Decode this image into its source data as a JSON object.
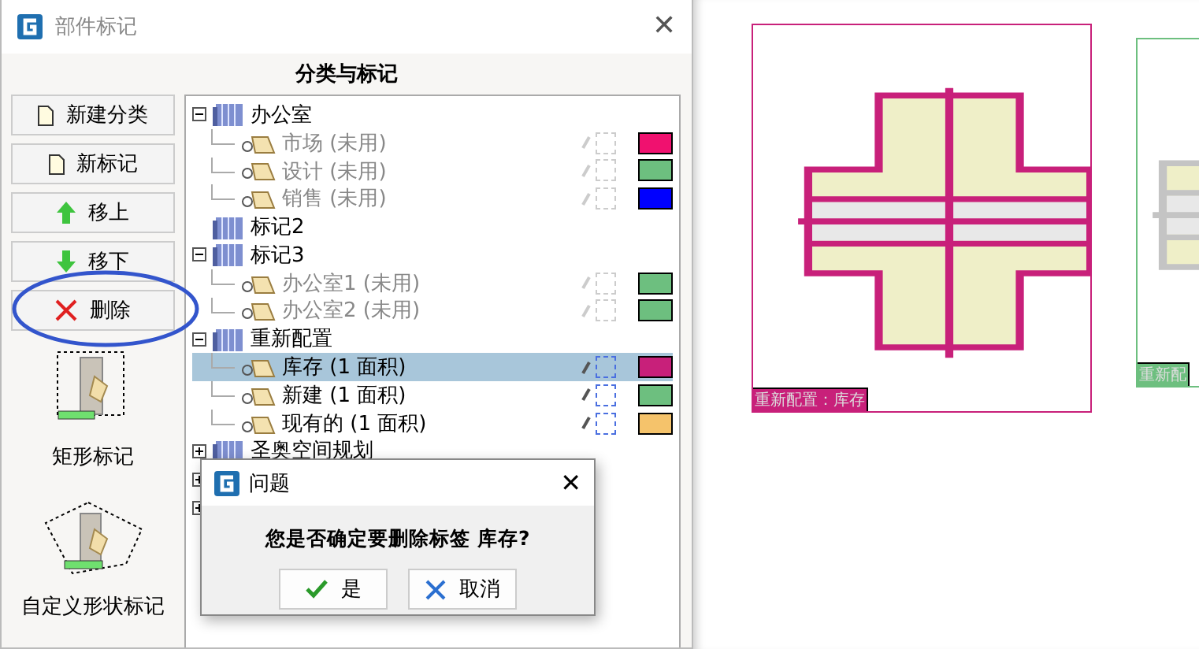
{
  "window": {
    "title": "部件标记",
    "close": "✕"
  },
  "header": "分类与标记",
  "buttons": [
    {
      "label": "新建分类",
      "kind": "doc",
      "circled": false
    },
    {
      "label": "新标记",
      "kind": "doc",
      "circled": false
    },
    {
      "label": "移上",
      "kind": "up",
      "circled": false
    },
    {
      "label": "移下",
      "kind": "down",
      "circled": false
    },
    {
      "label": "删除",
      "kind": "delete",
      "circled": true
    }
  ],
  "tools": [
    {
      "label": "矩形标记",
      "kind": "rect"
    },
    {
      "label": "自定义形状标记",
      "kind": "custom"
    }
  ],
  "tree": [
    {
      "label": "办公室",
      "expanded": true,
      "children": [
        {
          "label": "市场 (未用)",
          "used": false,
          "selected": false,
          "color": "#f0116f"
        },
        {
          "label": "设计 (未用)",
          "used": false,
          "selected": false,
          "color": "#6dbf7f"
        },
        {
          "label": "销售 (未用)",
          "used": false,
          "selected": false,
          "color": "#0000ff"
        }
      ]
    },
    {
      "label": "标记2"
    },
    {
      "label": "标记3",
      "expanded": true,
      "children": [
        {
          "label": "办公室1 (未用)",
          "used": false,
          "selected": false,
          "color": "#6dbf7f"
        },
        {
          "label": "办公室2 (未用)",
          "used": false,
          "selected": false,
          "color": "#6dbf7f"
        }
      ]
    },
    {
      "label": "重新配置",
      "expanded": true,
      "children": [
        {
          "label": "库存 (1 面积)",
          "used": true,
          "selected": true,
          "color": "#c8207a"
        },
        {
          "label": "新建 (1 面积)",
          "used": true,
          "selected": false,
          "color": "#6dbf7f"
        },
        {
          "label": "现有的 (1 面积)",
          "used": true,
          "selected": false,
          "color": "#f5c36b"
        }
      ]
    },
    {
      "label": "圣奥空间规划",
      "expanded": false
    },
    {
      "expanded": false
    },
    {
      "expanded": false
    }
  ],
  "canvas": {
    "marks": [
      {
        "label": "重新配置：库存",
        "color": "#c8207a",
        "kind": "selected"
      },
      {
        "label": "重新配",
        "color": "#6dbf7f",
        "kind": "other"
      }
    ]
  },
  "dialog": {
    "title": "问题",
    "close": "✕",
    "message": "您是否确定要删除标签 库存?",
    "buttons": [
      {
        "label": "是",
        "kind": "yes"
      },
      {
        "label": "取消",
        "kind": "cancel"
      }
    ]
  }
}
